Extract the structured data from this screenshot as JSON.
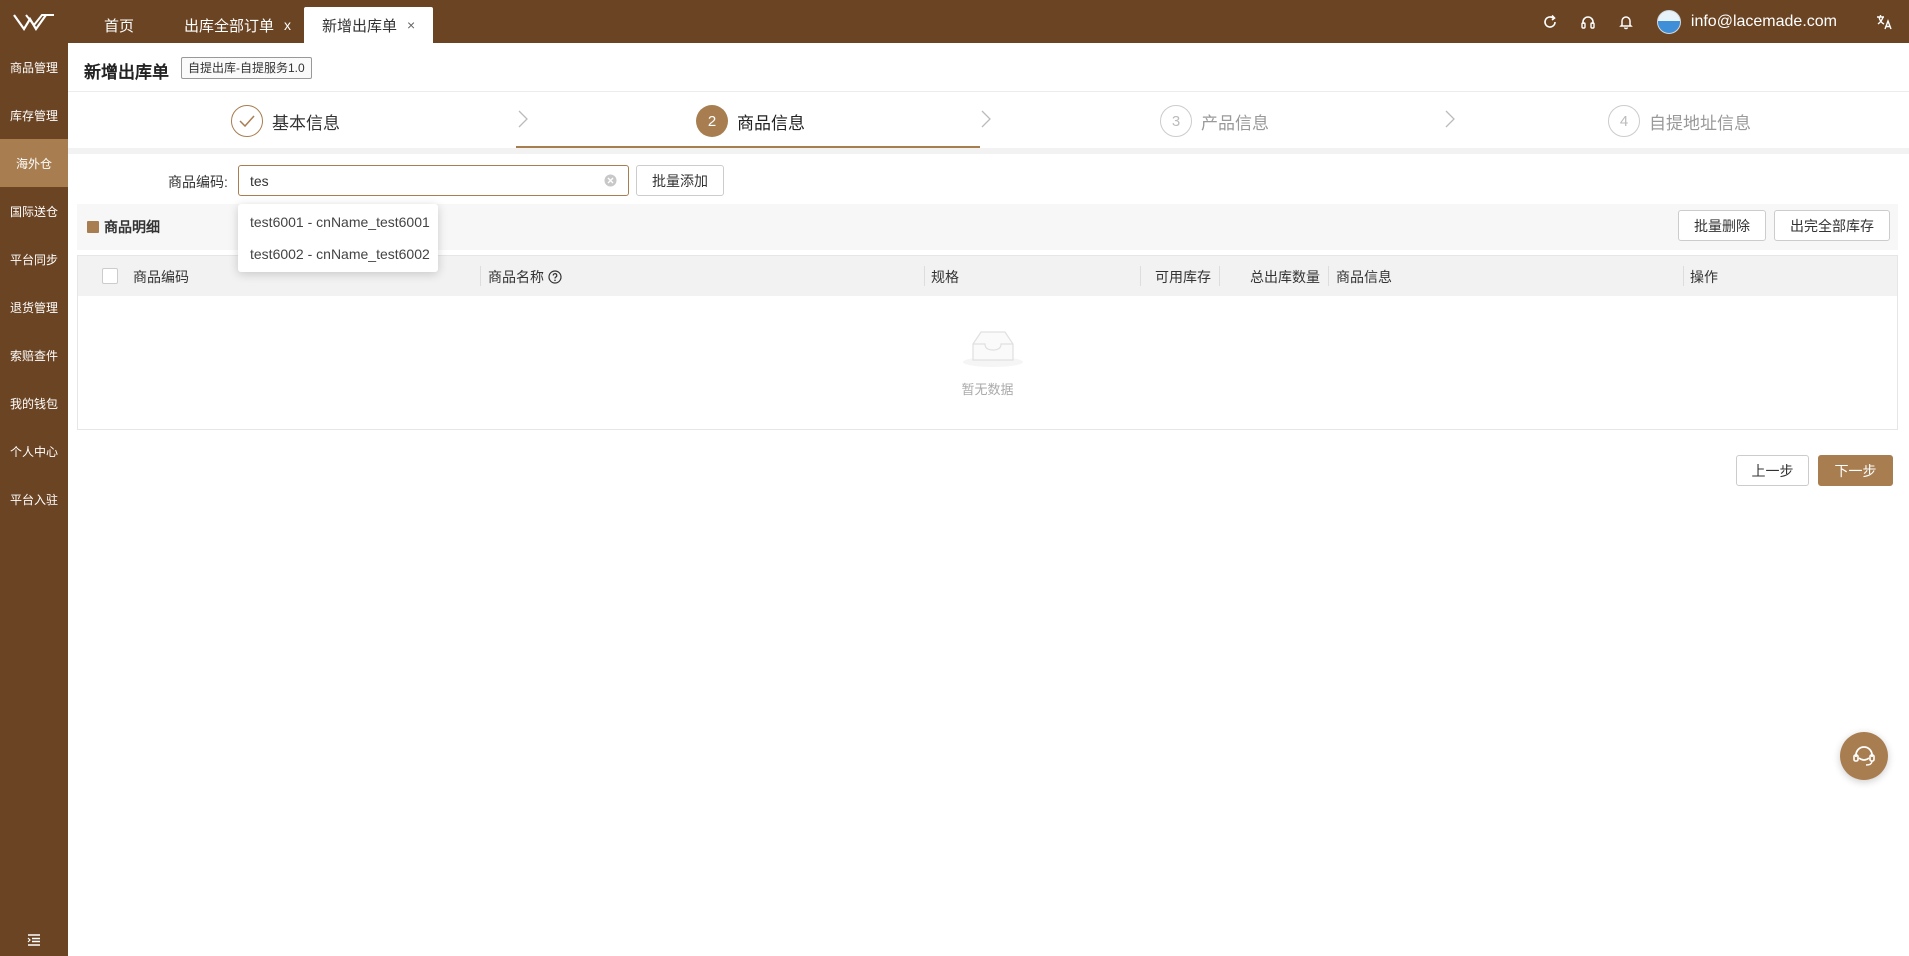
{
  "topbar": {
    "tabs": [
      {
        "label": "首页"
      },
      {
        "label": "出库全部订单",
        "close": "x"
      },
      {
        "label": "新增出库单",
        "close": "×"
      }
    ],
    "user_email": "info@lacemade.com"
  },
  "sidebar": {
    "items": [
      {
        "label": "商品管理"
      },
      {
        "label": "库存管理"
      },
      {
        "label": "海外仓"
      },
      {
        "label": "国际送仓"
      },
      {
        "label": "平台同步"
      },
      {
        "label": "退货管理"
      },
      {
        "label": "索赔查件"
      },
      {
        "label": "我的钱包"
      },
      {
        "label": "个人中心"
      },
      {
        "label": "平台入驻"
      }
    ],
    "active_index": 2
  },
  "header": {
    "title": "新增出库单",
    "type_badge": "自提出库-自提服务1.0"
  },
  "steps": [
    {
      "number": "1",
      "label": "基本信息",
      "state": "done"
    },
    {
      "number": "2",
      "label": "商品信息",
      "state": "active"
    },
    {
      "number": "3",
      "label": "产品信息",
      "state": "wait"
    },
    {
      "number": "4",
      "label": "自提地址信息",
      "state": "wait"
    }
  ],
  "search": {
    "label": "商品编码:",
    "value": "tes",
    "batch_add": "批量添加",
    "suggestions": [
      "test6001 - cnName_test6001",
      "test6002 - cnName_test6002"
    ]
  },
  "detail": {
    "title": "商品明细",
    "batch_delete": "批量删除",
    "out_all_stock": "出完全部库存"
  },
  "table": {
    "columns": [
      "商品编码",
      "商品名称",
      "规格",
      "可用库存",
      "总出库数量",
      "商品信息",
      "操作"
    ],
    "empty_text": "暂无数据"
  },
  "footer": {
    "prev": "上一步",
    "next": "下一步"
  },
  "colors": {
    "brand_dark": "#6b4423",
    "accent": "#a87e51"
  },
  "icons": [
    "logo-icon",
    "refresh-icon",
    "headset-icon",
    "bell-icon",
    "translate-icon",
    "check-icon",
    "chevron-right-icon",
    "clear-icon",
    "help-circle-icon",
    "empty-inbox-icon",
    "menu-collapse-icon",
    "customer-service-icon"
  ]
}
